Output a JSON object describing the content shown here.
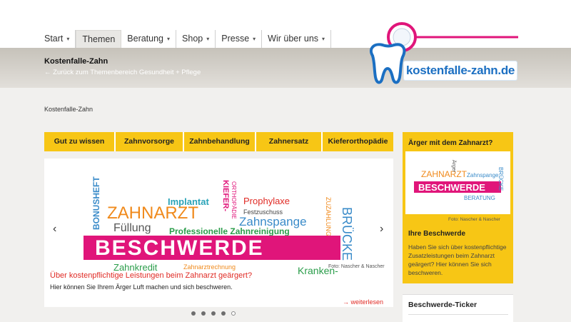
{
  "nav": {
    "items": [
      {
        "label": "Start",
        "chevron": "▾"
      },
      {
        "label": "Themen",
        "chevron": ""
      },
      {
        "label": "Beratung",
        "chevron": "▾"
      },
      {
        "label": "Shop",
        "chevron": "▾"
      },
      {
        "label": "Presse",
        "chevron": "▾"
      },
      {
        "label": "Wir über uns",
        "chevron": "▾"
      }
    ]
  },
  "header": {
    "title": "Kostenfalle-Zahn",
    "back_link": "← Zurück zum Themenbereich Gesundheit + Pflege"
  },
  "logo": {
    "text": "kostenfalle-zahn.de",
    "accent": "#e0157a",
    "blue": "#1b6fc2"
  },
  "breadcrumb": "Kostenfalle-Zahn",
  "tabs": [
    "Gut zu wissen",
    "Zahnvorsorge",
    "Zahnbehandlung",
    "Zahnersatz",
    "Kieferorthopädie"
  ],
  "slider": {
    "cloud": {
      "bonusheft": "BONUSHEFT",
      "zahnarzt": "ZAHNARZT",
      "implantat": "Implantat",
      "kiefer": "KIEFER-",
      "orthopaedie": "ORTHOPÄDIE",
      "prophylaxe": "Prophylaxe",
      "festzuschuss": "Festzuschuss",
      "zuzahlung": "ZUZAHLUNG",
      "fuellung": "Füllung",
      "zahnspange": "Zahnspange",
      "zahnreinigung": "Professionelle Zahnreinigung",
      "beschwerde": "BESCHWERDE",
      "bruecke": "BRÜCKE",
      "zahnkredit": "Zahnkredit",
      "zahnarztrechnung": "Zahnarztrechnung",
      "kranken": "Kranken-"
    },
    "caption": "Über kostenpflichtige Leistungen beim Zahnarzt geärgert?",
    "text": "Hier können Sie Ihrem Ärger Luft machen und sich beschweren.",
    "photo_credit": "Foto: Nascher & Nascher",
    "more": "weiterlesen",
    "prev": "‹",
    "next": "›",
    "slide_count": 5,
    "active_slide": 5
  },
  "sidebar": {
    "heading": "Ärger mit dem Zahnarzt?",
    "thumb_credit": "Foto: Nascher & Nascher",
    "title": "Ihre Beschwerde",
    "text": "Haben Sie sich über kostenpflichtige Zusatzleistungen beim Zahnarzt geärgert? Hier können Sie sich beschweren.",
    "thumb": {
      "zahnarzt": "ZAHNARZT",
      "zahnspange": "Zahnspange",
      "beschwerde": "BESCHWERDE",
      "bruecke": "BRÜCKE",
      "beratung": "BERATUNG",
      "aerger": "Ärger"
    }
  },
  "ticker": {
    "title": "Beschwerde-Ticker"
  },
  "colors": {
    "yellow": "#f7c615",
    "magenta": "#e0157a",
    "red": "#e02b25"
  }
}
